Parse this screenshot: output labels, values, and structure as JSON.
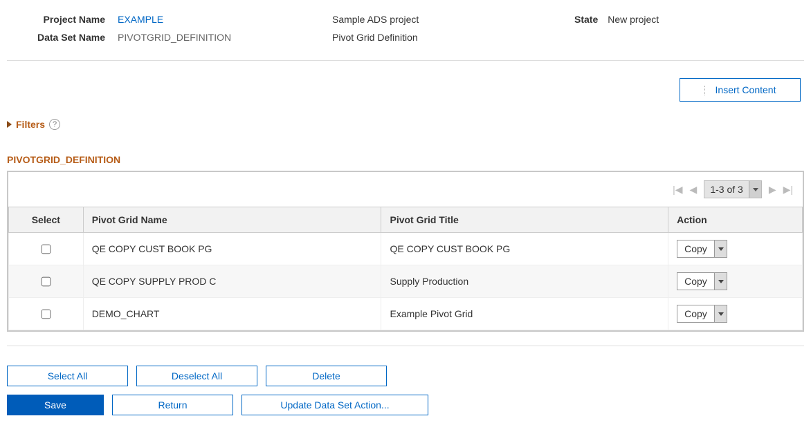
{
  "header": {
    "projectNameLabel": "Project Name",
    "projectName": "EXAMPLE",
    "projectDesc": "Sample ADS project",
    "dataSetNameLabel": "Data Set Name",
    "dataSetName": "PIVOTGRID_DEFINITION",
    "dataSetDesc": "Pivot Grid Definition",
    "stateLabel": "State",
    "stateValue": "New project"
  },
  "insertContentBtn": "Insert Content",
  "filters": {
    "label": "Filters",
    "help": "?"
  },
  "section": {
    "title": "PIVOTGRID_DEFINITION",
    "range": "1-3 of 3",
    "columns": {
      "select": "Select",
      "name": "Pivot Grid Name",
      "title": "Pivot Grid Title",
      "action": "Action"
    },
    "rows": [
      {
        "name": "QE COPY CUST BOOK PG",
        "title": "QE COPY CUST BOOK PG",
        "action": "Copy"
      },
      {
        "name": "QE COPY SUPPLY PROD C",
        "title": "Supply Production",
        "action": "Copy"
      },
      {
        "name": "DEMO_CHART",
        "title": "Example Pivot Grid",
        "action": "Copy"
      }
    ]
  },
  "footer": {
    "selectAll": "Select All",
    "deselectAll": "Deselect All",
    "delete": "Delete",
    "save": "Save",
    "return": "Return",
    "update": "Update Data Set Action..."
  }
}
